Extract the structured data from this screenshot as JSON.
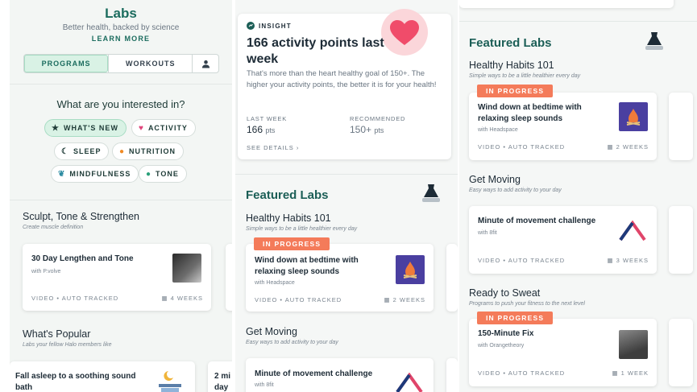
{
  "labs": {
    "title": "Labs",
    "subtitle": "Better health, backed by science",
    "learn_more": "LEARN MORE",
    "tab_programs": "PROGRAMS",
    "tab_workouts": "WORKOUTS",
    "question": "What are you interested in?",
    "chips": [
      {
        "label": "WHAT'S NEW",
        "icon": "star-icon"
      },
      {
        "label": "ACTIVITY",
        "icon": "heart-icon"
      },
      {
        "label": "SLEEP",
        "icon": "moon-icon"
      },
      {
        "label": "NUTRITION",
        "icon": "flame-icon"
      },
      {
        "label": "MINDFULNESS",
        "icon": "leaf-icon"
      },
      {
        "label": "TONE",
        "icon": "chat-icon"
      }
    ],
    "section1": {
      "title": "Sculpt, Tone & Strengthen",
      "subtitle": "Create muscle definition",
      "card": {
        "title": "30 Day Lengthen and Tone",
        "with": "with P.volve",
        "type": "VIDEO",
        "tracking": "AUTO TRACKED",
        "duration": "4 WEEKS"
      }
    },
    "section2": {
      "title": "What's Popular",
      "subtitle": "Labs your fellow Halo members like",
      "card": {
        "title": "Fall asleep to a soothing sound bath"
      },
      "card2_partial": "2 mi day"
    }
  },
  "insight": {
    "tag": "INSIGHT",
    "title": "166 activity points last week",
    "body": "That's more than the heart healthy goal of 150+. The higher your activity points, the better it is for your health!",
    "last_week_label": "LAST WEEK",
    "last_week_value": "166",
    "last_week_unit": "pts",
    "recommended_label": "RECOMMENDED",
    "recommended_value": "150+",
    "recommended_unit": "pts",
    "see_details": "SEE DETAILS"
  },
  "featured": {
    "title": "Featured Labs",
    "habits": {
      "title": "Healthy Habits 101",
      "subtitle": "Simple ways to be a little healthier every day",
      "badge": "IN PROGRESS",
      "card": {
        "title": "Wind down at bedtime with relaxing sleep sounds",
        "with": "with Headspace",
        "type": "VIDEO",
        "tracking": "AUTO TRACKED",
        "duration": "2 WEEKS"
      }
    },
    "moving": {
      "title": "Get Moving",
      "subtitle": "Easy ways to add activity to your day",
      "card": {
        "title": "Minute of movement challenge",
        "with": "with 8fit",
        "type": "VIDEO",
        "tracking": "AUTO TRACKED",
        "duration": "3 WEEKS"
      }
    },
    "sweat": {
      "title": "Ready to Sweat",
      "subtitle": "Programs to push your fitness to the next level",
      "badge": "IN PROGRESS",
      "card": {
        "title": "150-Minute Fix",
        "with": "with Orangetheory",
        "type": "VIDEO",
        "tracking": "AUTO TRACKED",
        "duration": "1 WEEK"
      }
    }
  },
  "colors": {
    "teal": "#1b6c5e",
    "orange": "#f47b5a",
    "mint": "#d9f2e5",
    "heart": "#f04c6a"
  }
}
